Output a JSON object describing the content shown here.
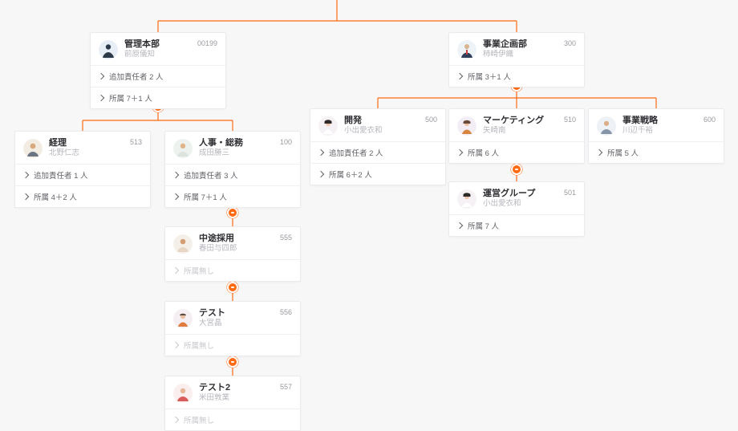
{
  "no_members_label": "所属無し",
  "nodes": {
    "kanri": {
      "dept": "管理本部",
      "manager": "前原儀知",
      "code": "00199",
      "rows": [
        "追加責任者 2 人",
        "所属 7＋1 人"
      ],
      "avatar": "suit"
    },
    "jigyo": {
      "dept": "事業企画部",
      "manager": "柿崎伊織",
      "code": "300",
      "rows": [
        "所属 3＋1 人"
      ],
      "avatar": "tie"
    },
    "keiri": {
      "dept": "経理",
      "manager": "北野仁志",
      "code": "513",
      "rows": [
        "追加責任者 1 人",
        "所属 4＋2 人"
      ],
      "avatar": "man1"
    },
    "jinji": {
      "dept": "人事・総務",
      "manager": "成田勝三",
      "code": "100",
      "rows": [
        "追加責任者 3 人",
        "所属 7＋1 人"
      ],
      "avatar": "man2"
    },
    "chuto": {
      "dept": "中途採用",
      "manager": "春田与四郎",
      "code": "555",
      "rows": [],
      "avatar": "man3"
    },
    "test": {
      "dept": "テスト",
      "manager": "大宮晶",
      "code": "556",
      "rows": [],
      "avatar": "woman1"
    },
    "test2": {
      "dept": "テスト2",
      "manager": "米田敦業",
      "code": "557",
      "rows": [],
      "avatar": "man4"
    },
    "kaihatsu": {
      "dept": "開発",
      "manager": "小出愛衣和",
      "code": "500",
      "rows": [
        "追加責任者 2 人",
        "所属 6＋2 人"
      ],
      "avatar": "woman2"
    },
    "marketing": {
      "dept": "マーケティング",
      "manager": "矢崎南",
      "code": "510",
      "rows": [
        "所属 6 人"
      ],
      "avatar": "woman3"
    },
    "senryaku": {
      "dept": "事業戦略",
      "manager": "川辺千裕",
      "code": "600",
      "rows": [
        "所属 5 人"
      ],
      "avatar": "man5"
    },
    "unei": {
      "dept": "運営グループ",
      "manager": "小出愛衣和",
      "code": "501",
      "rows": [
        "所属 7 人"
      ],
      "avatar": "woman2"
    }
  }
}
